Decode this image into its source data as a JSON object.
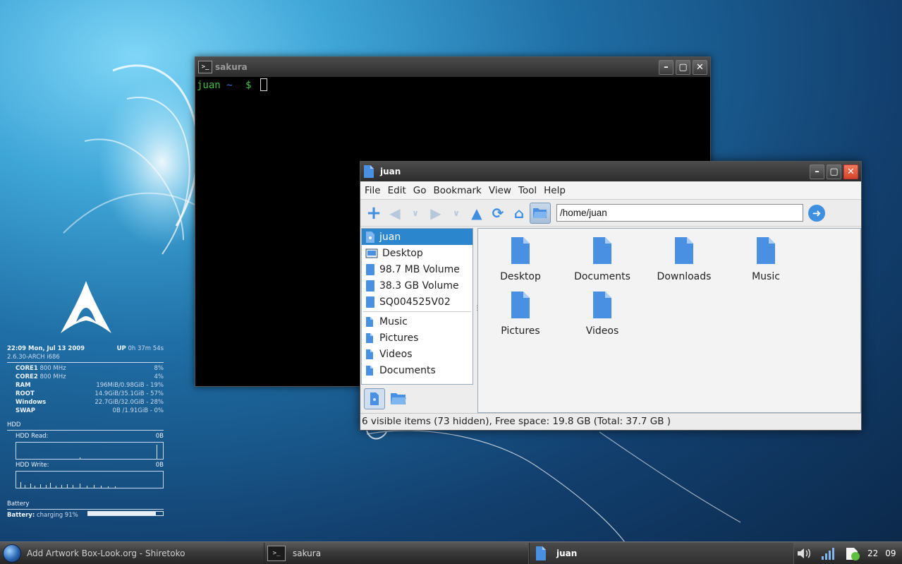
{
  "conky": {
    "datetime": "22:09 Mon, Jul 13 2009",
    "uptime_label": "UP",
    "uptime_value": "0h 37m 54s",
    "kernel": "2.6.30-ARCH i686",
    "stats": [
      {
        "label": "CORE1",
        "detail": "800 MHz",
        "value": "8%"
      },
      {
        "label": "CORE2",
        "detail": "800 MHz",
        "value": "4%"
      },
      {
        "label": "RAM",
        "detail": "",
        "value": "196MiB/0.98GiB - 19%"
      },
      {
        "label": "ROOT",
        "detail": "",
        "value": "14.9GiB/35.1GiB - 57%"
      },
      {
        "label": "Windows",
        "detail": "",
        "value": "22.7GiB/32.0GiB - 28%"
      },
      {
        "label": "SWAP",
        "detail": "",
        "value": "0B  /1.91GiB - 0%"
      }
    ],
    "hdd_title": "HDD",
    "hdd_read_label": "HDD Read:",
    "hdd_read_value": "0B",
    "hdd_write_label": "HDD Write:",
    "hdd_write_value": "0B",
    "battery_title": "Battery",
    "battery_label": "Battery:",
    "battery_status": "charging 91%",
    "battery_level": 0.91
  },
  "terminal": {
    "title": "sakura",
    "prompt_user": "juan",
    "prompt_path": "~",
    "prompt_sign": "$"
  },
  "filemanager": {
    "title": "juan",
    "menu": [
      "File",
      "Edit",
      "Go",
      "Bookmark",
      "View",
      "Tool",
      "Help"
    ],
    "address": "/home/juan",
    "sidebar_places": [
      "juan",
      "Desktop",
      "98.7 MB Volume",
      "38.3 GB Volume",
      "SQ004525V02"
    ],
    "sidebar_bookmarks": [
      "Music",
      "Pictures",
      "Videos",
      "Documents"
    ],
    "files": [
      "Desktop",
      "Documents",
      "Downloads",
      "Music",
      "Pictures",
      "Videos"
    ],
    "status": "6 visible items (73 hidden), Free space: 19.8 GB (Total: 37.7 GB )"
  },
  "taskbar": {
    "launcher_text": "Add  Artwork Box-Look.org - Shiretoko",
    "tasks": [
      "sakura",
      "juan"
    ],
    "tray_text_1": "22",
    "tray_text_2": "09"
  },
  "colors": {
    "accent": "#2c86cd",
    "folder": "#4a90e2",
    "prompt_green": "#3ec23e",
    "prompt_blue": "#3b6fd6"
  }
}
